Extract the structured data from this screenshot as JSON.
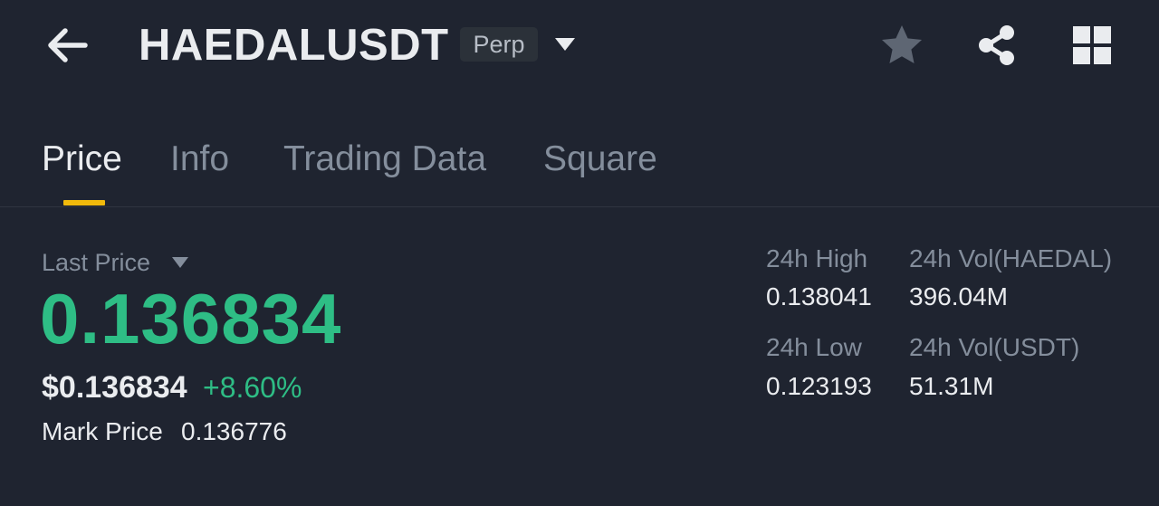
{
  "header": {
    "symbol": "HAEDALUSDT",
    "contract_type": "Perp",
    "icons": {
      "back": "back-arrow-icon",
      "dropdown": "caret-down-icon",
      "favorite": "star-icon",
      "share": "share-icon",
      "layout": "grid-icon"
    }
  },
  "tabs": [
    {
      "label": "Price",
      "active": true
    },
    {
      "label": "Info",
      "active": false
    },
    {
      "label": "Trading Data",
      "active": false
    },
    {
      "label": "Square",
      "active": false
    }
  ],
  "price": {
    "label": "Last Price",
    "value": "0.136834",
    "usd_value": "$0.136834",
    "change_pct": "+8.60%",
    "mark_label": "Mark Price",
    "mark_value": "0.136776"
  },
  "stats": {
    "high_label": "24h High",
    "high_value": "0.138041",
    "low_label": "24h Low",
    "low_value": "0.123193",
    "vol_base_label": "24h Vol(HAEDAL)",
    "vol_base_value": "396.04M",
    "vol_quote_label": "24h Vol(USDT)",
    "vol_quote_value": "51.31M"
  },
  "colors": {
    "background": "#1f2430",
    "accent": "#f0b90b",
    "up": "#2ebd85",
    "text_primary": "#eaecef",
    "text_secondary": "#848e9c"
  }
}
